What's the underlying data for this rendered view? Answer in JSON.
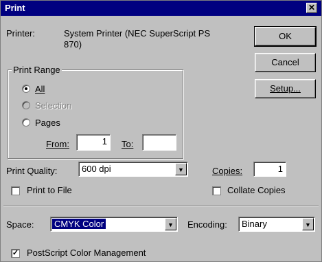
{
  "window": {
    "title": "Print",
    "close_glyph": "✕"
  },
  "printer": {
    "label": "Printer:",
    "name_line1": "System Printer (NEC SuperScript PS",
    "name_line2": "870)"
  },
  "buttons": {
    "ok": "OK",
    "cancel": "Cancel",
    "setup": "Setup..."
  },
  "print_range": {
    "label": "Print Range",
    "all": "All",
    "selection": "Selection",
    "pages": "Pages",
    "from_label": "From:",
    "from_value": "1",
    "to_label": "To:",
    "to_value": ""
  },
  "print_quality": {
    "label": "Print Quality:",
    "value": "600 dpi"
  },
  "copies": {
    "label": "Copies:",
    "value": "1"
  },
  "print_to_file": {
    "label": "Print to File",
    "checked": false
  },
  "collate": {
    "label": "Collate Copies",
    "checked": false
  },
  "space": {
    "label": "Space:",
    "value": "CMYK Color"
  },
  "encoding": {
    "label": "Encoding:",
    "value": "Binary"
  },
  "postscript_cm": {
    "label": "PostScript Color Management",
    "checked": true,
    "check_glyph": "✓"
  },
  "icons": {
    "dropdown": "▼"
  },
  "colors": {
    "titlebar": "#000080",
    "face": "#c0c0c0",
    "highlight": "#000080"
  }
}
